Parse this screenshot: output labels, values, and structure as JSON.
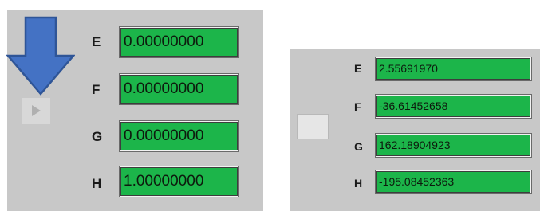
{
  "left_panel": {
    "rows": [
      {
        "label": "E",
        "value": "0.00000000"
      },
      {
        "label": "F",
        "value": "0.00000000"
      },
      {
        "label": "G",
        "value": "0.00000000"
      },
      {
        "label": "H",
        "value": "1.00000000"
      }
    ],
    "run_button_icon": "play-icon",
    "annotation_icon": "down-arrow-icon"
  },
  "right_panel": {
    "rows": [
      {
        "label": "E",
        "value": "2.55691970"
      },
      {
        "label": "F",
        "value": "-36.61452658"
      },
      {
        "label": "G",
        "value": "162.18904923"
      },
      {
        "label": "H",
        "value": "-195.08452363"
      }
    ]
  },
  "colors": {
    "panel_background": "#c8c8c8",
    "field_green": "#1cb54a",
    "arrow_blue": "#4472c4"
  }
}
